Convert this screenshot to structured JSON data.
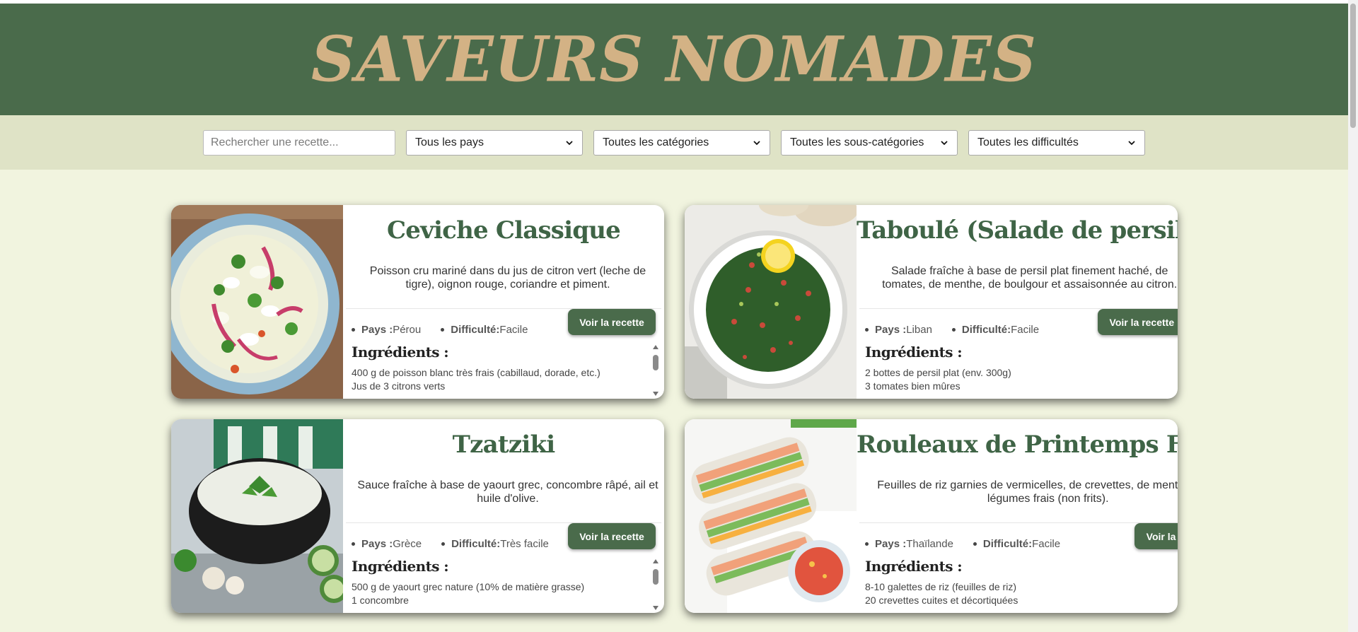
{
  "site": {
    "title": "SAVEURS NOMADES"
  },
  "filters": {
    "search_placeholder": "Rechercher une recette...",
    "country": "Tous les pays",
    "category": "Toutes les catégories",
    "subcategory": "Toutes les sous-catégories",
    "difficulty": "Toutes les difficultés"
  },
  "labels": {
    "country": "Pays :",
    "difficulty": "Difficulté:",
    "ingredients": "Ingrédients :",
    "view_recipe": "Voir la recette"
  },
  "recipes": [
    {
      "title": "Ceviche Classique",
      "description": "Poisson cru mariné dans du jus de citron vert (leche de tigre), oignon rouge, coriandre et piment.",
      "country": "Pérou",
      "difficulty": "Facile",
      "ingredients": [
        "400 g de poisson blanc très frais (cabillaud, dorade, etc.)",
        "Jus de 3 citrons verts"
      ],
      "image_icon": "ceviche-photo"
    },
    {
      "title": "Taboulé (Salade de persil)",
      "description": "Salade fraîche à base de persil plat finement haché, de tomates, de menthe, de boulgour et assaisonnée au citron.",
      "country": "Liban",
      "difficulty": "Facile",
      "ingredients": [
        "2 bottes de persil plat (env. 300g)",
        "3 tomates bien mûres"
      ],
      "image_icon": "taboule-photo"
    },
    {
      "title": "Tzatziki",
      "description": "Sauce fraîche à base de yaourt grec, concombre râpé, ail et huile d'olive.",
      "country": "Grèce",
      "difficulty": "Très facile",
      "ingredients": [
        "500 g de yaourt grec nature (10% de matière grasse)",
        "1 concombre"
      ],
      "image_icon": "tzatziki-photo"
    },
    {
      "title": "Rouleaux de Printemps Frais",
      "description": "Feuilles de riz garnies de vermicelles, de crevettes, de menthe et de légumes frais (non frits).",
      "country": "Thaïlande",
      "difficulty": "Facile",
      "ingredients": [
        "8-10 galettes de riz (feuilles de riz)",
        "20 crevettes cuites et décortiquées"
      ],
      "image_icon": "spring-rolls-photo"
    }
  ],
  "colors": {
    "banner": "#4a6b4b",
    "title": "#d3b285",
    "filterbar": "#dfe3c6",
    "page": "#f1f4df",
    "card_title": "#3f6446"
  }
}
